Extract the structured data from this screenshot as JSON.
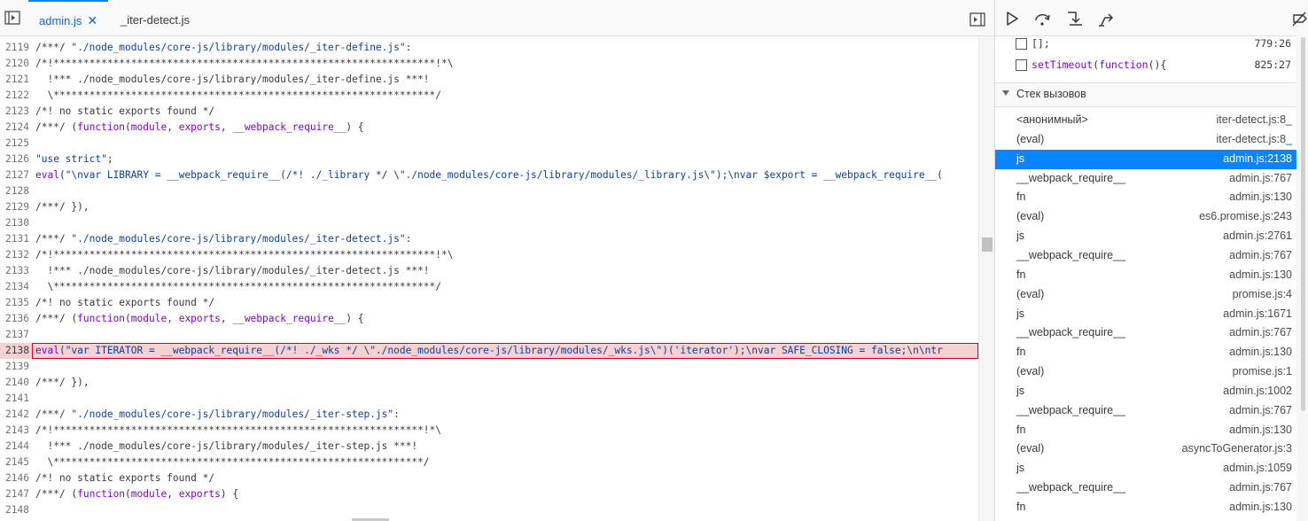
{
  "tabs": [
    {
      "label": "admin.js",
      "active": true,
      "close": "✕"
    },
    {
      "label": "_iter-detect.js",
      "active": false
    }
  ],
  "editor": {
    "lines": [
      {
        "n": "2119",
        "segs": [
          {
            "t": "/***/ ",
            "c": "cmt"
          },
          {
            "t": "\"./node_modules/core-js/library/modules/_iter-define.js\"",
            "c": "str"
          },
          {
            "t": ":",
            "c": "cmt"
          }
        ]
      },
      {
        "n": "2120",
        "segs": [
          {
            "t": "/*!****************************************************************!*\\",
            "c": "cmt"
          }
        ]
      },
      {
        "n": "2121",
        "segs": [
          {
            "t": "  !*** ./node_modules/core-js/library/modules/_iter-define.js ***!",
            "c": "cmt"
          }
        ]
      },
      {
        "n": "2122",
        "segs": [
          {
            "t": "  \\****************************************************************/",
            "c": "cmt"
          }
        ]
      },
      {
        "n": "2123",
        "segs": [
          {
            "t": "/*! no static exports found */",
            "c": "cmt"
          }
        ]
      },
      {
        "n": "2124",
        "segs": [
          {
            "t": "/***/ (",
            "c": "cmt"
          },
          {
            "t": "function",
            "c": "kw"
          },
          {
            "t": "(",
            "c": "cmt"
          },
          {
            "t": "module",
            "c": "kw"
          },
          {
            "t": ", ",
            "c": "cmt"
          },
          {
            "t": "exports",
            "c": "kw"
          },
          {
            "t": ", ",
            "c": "cmt"
          },
          {
            "t": "__webpack_require__",
            "c": "kw"
          },
          {
            "t": ") {",
            "c": "cmt"
          }
        ]
      },
      {
        "n": "2125",
        "segs": []
      },
      {
        "n": "2126",
        "segs": [
          {
            "t": "\"use strict\"",
            "c": "str"
          },
          {
            "t": ";",
            "c": "cmt"
          }
        ]
      },
      {
        "n": "2127",
        "segs": [
          {
            "t": "eval",
            "c": "kw"
          },
          {
            "t": "(\"\\nvar LIBRARY = __webpack_require__(/*! ./_library */ \\\"./node_modules/core-js/library/modules/_library.js\\\");\\nvar $export = __webpack_require__(",
            "c": "str"
          }
        ]
      },
      {
        "n": "2128",
        "segs": []
      },
      {
        "n": "2129",
        "segs": [
          {
            "t": "/***/ }),",
            "c": "cmt"
          }
        ]
      },
      {
        "n": "2130",
        "segs": []
      },
      {
        "n": "2131",
        "segs": [
          {
            "t": "/***/ ",
            "c": "cmt"
          },
          {
            "t": "\"./node_modules/core-js/library/modules/_iter-detect.js\"",
            "c": "str"
          },
          {
            "t": ":",
            "c": "cmt"
          }
        ]
      },
      {
        "n": "2132",
        "segs": [
          {
            "t": "/*!****************************************************************!*\\",
            "c": "cmt"
          }
        ]
      },
      {
        "n": "2133",
        "segs": [
          {
            "t": "  !*** ./node_modules/core-js/library/modules/_iter-detect.js ***!",
            "c": "cmt"
          }
        ]
      },
      {
        "n": "2134",
        "segs": [
          {
            "t": "  \\****************************************************************/",
            "c": "cmt"
          }
        ]
      },
      {
        "n": "2135",
        "segs": [
          {
            "t": "/*! no static exports found */",
            "c": "cmt"
          }
        ]
      },
      {
        "n": "2136",
        "segs": [
          {
            "t": "/***/ (",
            "c": "cmt"
          },
          {
            "t": "function",
            "c": "kw"
          },
          {
            "t": "(",
            "c": "cmt"
          },
          {
            "t": "module",
            "c": "kw"
          },
          {
            "t": ", ",
            "c": "cmt"
          },
          {
            "t": "exports",
            "c": "kw"
          },
          {
            "t": ", ",
            "c": "cmt"
          },
          {
            "t": "__webpack_require__",
            "c": "kw"
          },
          {
            "t": ") {",
            "c": "cmt"
          }
        ]
      },
      {
        "n": "2137",
        "segs": []
      },
      {
        "n": "2138",
        "hl": true,
        "segs": [
          {
            "t": "eval",
            "c": "kw"
          },
          {
            "t": "(\"var ITERATOR = __webpack_require__(/*! ./_wks */ \\\"./node_modules/core-js/library/modules/_wks.js\\\")('iterator');\\nvar SAFE_CLOSING = false;\\n\\ntr",
            "c": "str"
          }
        ]
      },
      {
        "n": "2139",
        "segs": []
      },
      {
        "n": "2140",
        "segs": [
          {
            "t": "/***/ }),",
            "c": "cmt"
          }
        ]
      },
      {
        "n": "2141",
        "segs": []
      },
      {
        "n": "2142",
        "segs": [
          {
            "t": "/***/ ",
            "c": "cmt"
          },
          {
            "t": "\"./node_modules/core-js/library/modules/_iter-step.js\"",
            "c": "str"
          },
          {
            "t": ":",
            "c": "cmt"
          }
        ]
      },
      {
        "n": "2143",
        "segs": [
          {
            "t": "/*!**************************************************************!*\\",
            "c": "cmt"
          }
        ]
      },
      {
        "n": "2144",
        "segs": [
          {
            "t": "  !*** ./node_modules/core-js/library/modules/_iter-step.js ***!",
            "c": "cmt"
          }
        ]
      },
      {
        "n": "2145",
        "segs": [
          {
            "t": "  \\**************************************************************/",
            "c": "cmt"
          }
        ]
      },
      {
        "n": "2146",
        "segs": [
          {
            "t": "/*! no static exports found */",
            "c": "cmt"
          }
        ]
      },
      {
        "n": "2147",
        "segs": [
          {
            "t": "/***/ (",
            "c": "cmt"
          },
          {
            "t": "function",
            "c": "kw"
          },
          {
            "t": "(",
            "c": "cmt"
          },
          {
            "t": "module",
            "c": "kw"
          },
          {
            "t": ", ",
            "c": "cmt"
          },
          {
            "t": "exports",
            "c": "kw"
          },
          {
            "t": ") {",
            "c": "cmt"
          }
        ]
      },
      {
        "n": "2148",
        "segs": []
      }
    ]
  },
  "breakpoints": [
    {
      "text": "[];",
      "loc": "779:26"
    },
    {
      "text": "setTimeout(function(){",
      "loc": "825:27"
    }
  ],
  "callstack": {
    "title": "Стек вызовов",
    "frames": [
      {
        "fn": "<анонимный>",
        "loc": "iter-detect.js:8_"
      },
      {
        "fn": "(eval)",
        "loc": "iter-detect.js:8_"
      },
      {
        "fn": "js",
        "loc": "admin.js:2138",
        "selected": true
      },
      {
        "fn": "__webpack_require__",
        "loc": "admin.js:767"
      },
      {
        "fn": "fn",
        "loc": "admin.js:130"
      },
      {
        "fn": "(eval)",
        "loc": "es6.promise.js:243"
      },
      {
        "fn": "js",
        "loc": "admin.js:2761"
      },
      {
        "fn": "__webpack_require__",
        "loc": "admin.js:767"
      },
      {
        "fn": "fn",
        "loc": "admin.js:130"
      },
      {
        "fn": "(eval)",
        "loc": "promise.js:4"
      },
      {
        "fn": "js",
        "loc": "admin.js:1671"
      },
      {
        "fn": "__webpack_require__",
        "loc": "admin.js:767"
      },
      {
        "fn": "fn",
        "loc": "admin.js:130"
      },
      {
        "fn": "(eval)",
        "loc": "promise.js:1"
      },
      {
        "fn": "js",
        "loc": "admin.js:1002"
      },
      {
        "fn": "__webpack_require__",
        "loc": "admin.js:767"
      },
      {
        "fn": "fn",
        "loc": "admin.js:130"
      },
      {
        "fn": "(eval)",
        "loc": "asyncToGenerator.js:3"
      },
      {
        "fn": "js",
        "loc": "admin.js:1059"
      },
      {
        "fn": "__webpack_require__",
        "loc": "admin.js:767"
      },
      {
        "fn": "fn",
        "loc": "admin.js:130"
      }
    ]
  },
  "icons": {
    "sidebar_toggle": "sidebar-toggle-icon",
    "resume": "resume-icon",
    "step_over": "step-over-icon",
    "step_in": "step-in-icon",
    "step_out": "step-out-icon",
    "deactivate_breakpoints": "deactivate-breakpoints-icon"
  }
}
